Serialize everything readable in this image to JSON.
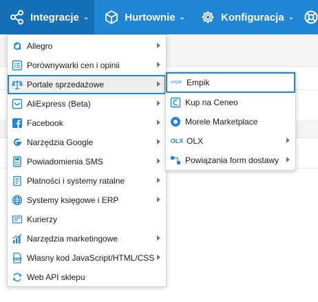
{
  "nav": {
    "items": [
      {
        "label": "Integracje",
        "icon": "share-nodes-icon"
      },
      {
        "label": "Hurtownie",
        "icon": "cube-icon"
      },
      {
        "label": "Konfiguracja",
        "icon": "gear-icon"
      }
    ]
  },
  "menu": {
    "items": [
      {
        "label": "Allegro",
        "icon": "allegro-logo-icon",
        "submenu": true
      },
      {
        "label": "Porównywarki cen i opinii",
        "icon": "list-icon",
        "submenu": true
      },
      {
        "label": "Portale sprzedażowe",
        "icon": "scales-icon",
        "submenu": true
      },
      {
        "label": "AliExpress (Beta)",
        "icon": "aliexpress-icon",
        "submenu": true
      },
      {
        "label": "Facebook",
        "icon": "facebook-icon",
        "submenu": true
      },
      {
        "label": "Narzędzia Google",
        "icon": "google-icon",
        "submenu": true
      },
      {
        "label": "Powiadomienia SMS",
        "icon": "calculator-icon",
        "submenu": true
      },
      {
        "label": "Płatności i systemy ratalne",
        "icon": "money-icon",
        "submenu": true
      },
      {
        "label": "Systemy księgowe i ERP",
        "icon": "globe-icon",
        "submenu": true
      },
      {
        "label": "Kurierzy",
        "icon": "truck-icon",
        "submenu": false
      },
      {
        "label": "Narzędzia marketingowe",
        "icon": "chart-icon",
        "submenu": true
      },
      {
        "label": "Własny kod JavaScript/HTML/CSS",
        "icon": "html-file-icon",
        "submenu": true
      },
      {
        "label": "Web API sklepu",
        "icon": "refresh-icon",
        "submenu": false
      }
    ]
  },
  "submenu": {
    "items": [
      {
        "label": "Empik",
        "icon": "empik-logo-icon",
        "icon_text": "empik",
        "submenu": false
      },
      {
        "label": "Kup na Ceneo",
        "icon": "ceneo-icon",
        "submenu": false
      },
      {
        "label": "Morele Marketplace",
        "icon": "morele-icon",
        "submenu": false
      },
      {
        "label": "OLX",
        "icon": "olx-icon",
        "icon_text": "OLX",
        "submenu": true
      },
      {
        "label": "Powiązania form dostawy",
        "icon": "link-icon",
        "submenu": true
      }
    ]
  },
  "colors": {
    "topbar": "#1f86d6",
    "highlight_border": "#1f86d6"
  }
}
